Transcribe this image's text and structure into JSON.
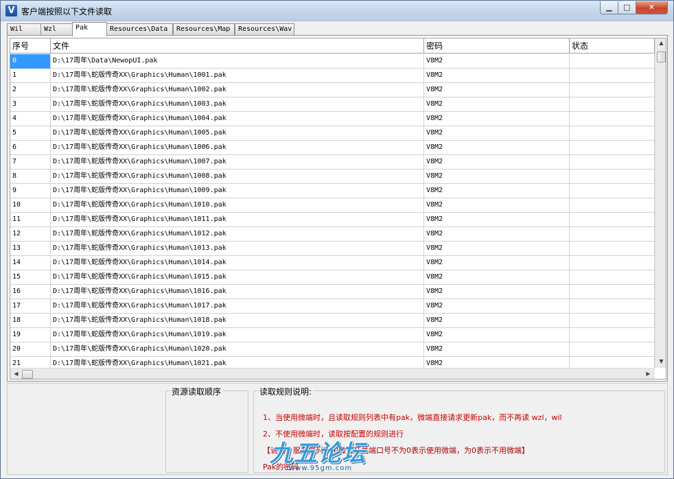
{
  "window": {
    "title": "客户端按照以下文件读取",
    "icon_letter": "V"
  },
  "titlebar_controls": {
    "minimize": "▁",
    "maximize": "□",
    "close": "✕"
  },
  "tabs": [
    {
      "label": "Wil",
      "active": false
    },
    {
      "label": "Wzl",
      "active": false
    },
    {
      "label": "Pak",
      "active": true
    },
    {
      "label": "Resources\\Data",
      "active": false
    },
    {
      "label": "Resources\\Map",
      "active": false
    },
    {
      "label": "Resources\\Wav",
      "active": false
    }
  ],
  "table": {
    "columns": [
      "序号",
      "文件",
      "密码",
      "状态"
    ],
    "rows": [
      {
        "index": "0",
        "file": "D:\\17周年\\Data\\NewopUI.pak",
        "password": "V8M2",
        "status": ""
      },
      {
        "index": "1",
        "file": "D:\\17周年\\蛇版传奇XX\\Graphics\\Human\\1001.pak",
        "password": "V8M2",
        "status": ""
      },
      {
        "index": "2",
        "file": "D:\\17周年\\蛇版传奇XX\\Graphics\\Human\\1002.pak",
        "password": "V8M2",
        "status": ""
      },
      {
        "index": "3",
        "file": "D:\\17周年\\蛇版传奇XX\\Graphics\\Human\\1003.pak",
        "password": "V8M2",
        "status": ""
      },
      {
        "index": "4",
        "file": "D:\\17周年\\蛇版传奇XX\\Graphics\\Human\\1004.pak",
        "password": "V8M2",
        "status": ""
      },
      {
        "index": "5",
        "file": "D:\\17周年\\蛇版传奇XX\\Graphics\\Human\\1005.pak",
        "password": "V8M2",
        "status": ""
      },
      {
        "index": "6",
        "file": "D:\\17周年\\蛇版传奇XX\\Graphics\\Human\\1006.pak",
        "password": "V8M2",
        "status": ""
      },
      {
        "index": "7",
        "file": "D:\\17周年\\蛇版传奇XX\\Graphics\\Human\\1007.pak",
        "password": "V8M2",
        "status": ""
      },
      {
        "index": "8",
        "file": "D:\\17周年\\蛇版传奇XX\\Graphics\\Human\\1008.pak",
        "password": "V8M2",
        "status": ""
      },
      {
        "index": "9",
        "file": "D:\\17周年\\蛇版传奇XX\\Graphics\\Human\\1009.pak",
        "password": "V8M2",
        "status": ""
      },
      {
        "index": "10",
        "file": "D:\\17周年\\蛇版传奇XX\\Graphics\\Human\\1010.pak",
        "password": "V8M2",
        "status": ""
      },
      {
        "index": "11",
        "file": "D:\\17周年\\蛇版传奇XX\\Graphics\\Human\\1011.pak",
        "password": "V8M2",
        "status": ""
      },
      {
        "index": "12",
        "file": "D:\\17周年\\蛇版传奇XX\\Graphics\\Human\\1012.pak",
        "password": "V8M2",
        "status": ""
      },
      {
        "index": "13",
        "file": "D:\\17周年\\蛇版传奇XX\\Graphics\\Human\\1013.pak",
        "password": "V8M2",
        "status": ""
      },
      {
        "index": "14",
        "file": "D:\\17周年\\蛇版传奇XX\\Graphics\\Human\\1014.pak",
        "password": "V8M2",
        "status": ""
      },
      {
        "index": "15",
        "file": "D:\\17周年\\蛇版传奇XX\\Graphics\\Human\\1015.pak",
        "password": "V8M2",
        "status": ""
      },
      {
        "index": "16",
        "file": "D:\\17周年\\蛇版传奇XX\\Graphics\\Human\\1016.pak",
        "password": "V8M2",
        "status": ""
      },
      {
        "index": "17",
        "file": "D:\\17周年\\蛇版传奇XX\\Graphics\\Human\\1017.pak",
        "password": "V8M2",
        "status": ""
      },
      {
        "index": "18",
        "file": "D:\\17周年\\蛇版传奇XX\\Graphics\\Human\\1018.pak",
        "password": "V8M2",
        "status": ""
      },
      {
        "index": "19",
        "file": "D:\\17周年\\蛇版传奇XX\\Graphics\\Human\\1019.pak",
        "password": "V8M2",
        "status": ""
      },
      {
        "index": "20",
        "file": "D:\\17周年\\蛇版传奇XX\\Graphics\\Human\\1020.pak",
        "password": "V8M2",
        "status": ""
      },
      {
        "index": "21",
        "file": "D:\\17周年\\蛇版传奇XX\\Graphics\\Human\\1021.pak",
        "password": "V8M2",
        "status": ""
      }
    ],
    "selected_row": 0
  },
  "resource_order": {
    "title": "资源读取顺序"
  },
  "rules": {
    "title": "读取规则说明:",
    "lines": [
      "1、当使用微端时，且读取规则列表中有pak，微端直接请求更新pak，而不再读 wzl，wil",
      "2、不使用微端时，读取按配置的规则进行",
      "【说明：服务器列表中微端开关端口号不为0表示使用微端，为0表示不用微端】",
      "Pak的密码"
    ]
  },
  "watermark": {
    "text": "九五论坛",
    "url": "www.95gm.com"
  },
  "colors": {
    "selection": "#3399ff",
    "rule_text": "#cc0000",
    "close_button": "#c7462b"
  }
}
